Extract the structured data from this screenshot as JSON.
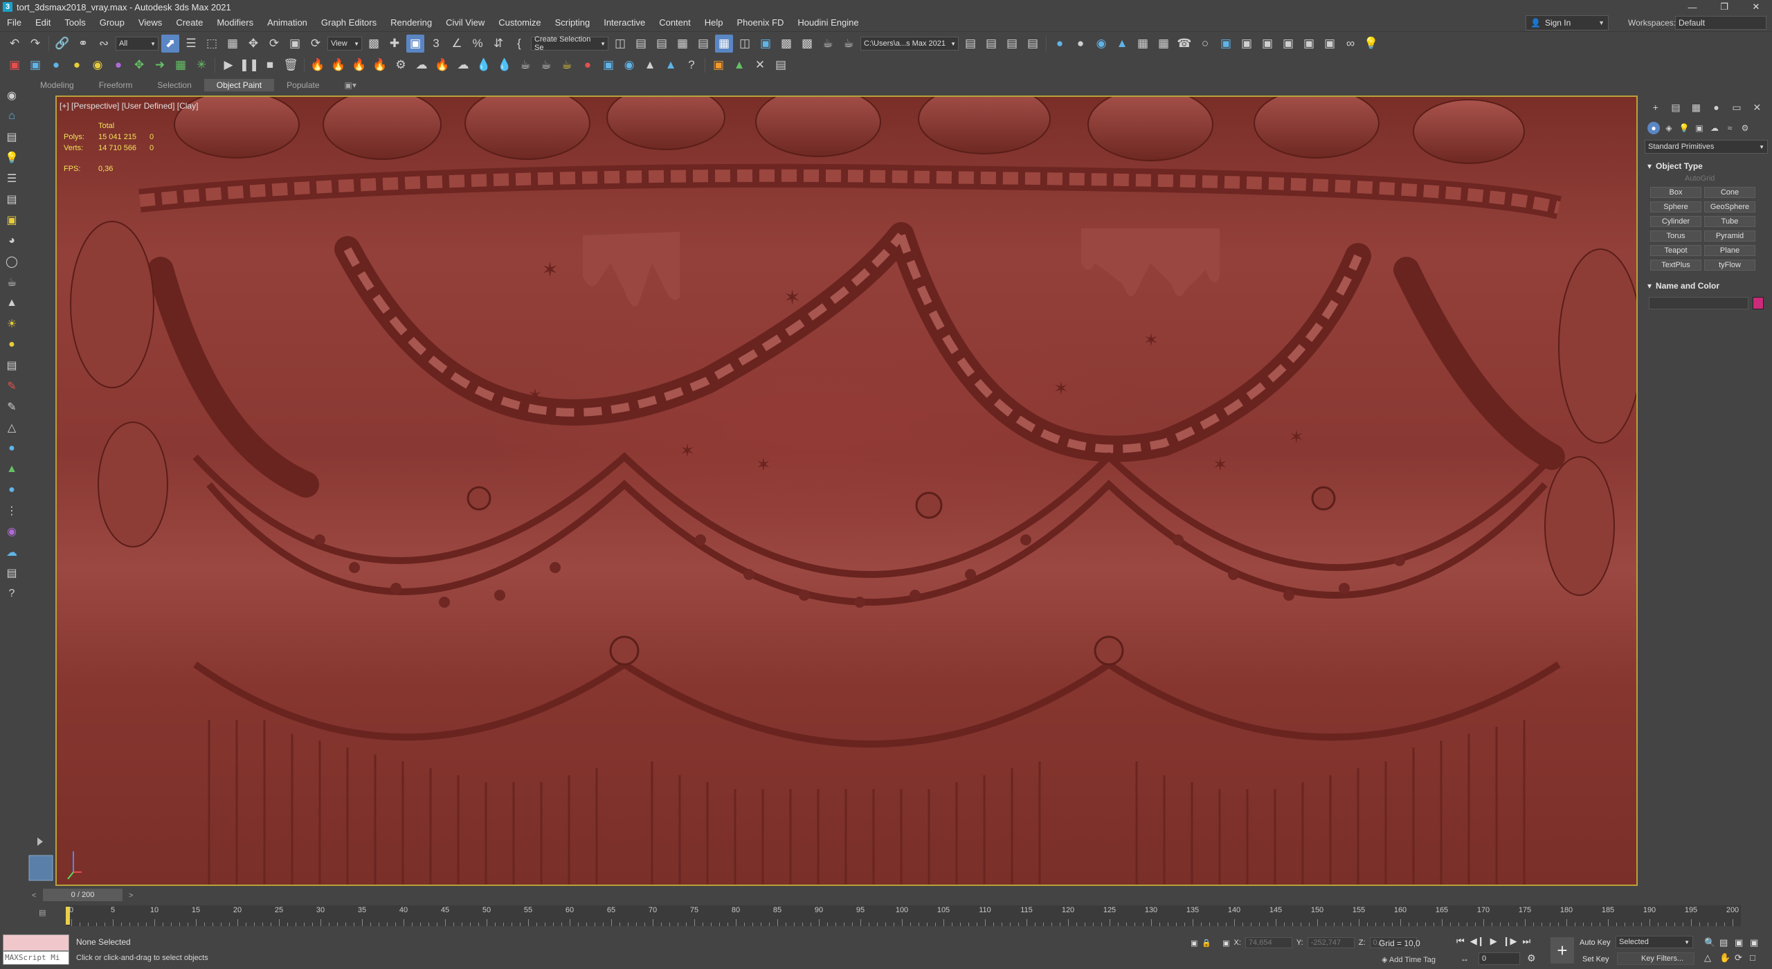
{
  "window": {
    "title": "tort_3dsmax2018_vray.max - Autodesk 3ds Max 2021",
    "app_icon": "3",
    "minimize": "—",
    "maximize": "❐",
    "close": "✕"
  },
  "menu": [
    "File",
    "Edit",
    "Tools",
    "Group",
    "Views",
    "Create",
    "Modifiers",
    "Animation",
    "Graph Editors",
    "Rendering",
    "Civil View",
    "Customize",
    "Scripting",
    "Interactive",
    "Content",
    "Help",
    "Phoenix FD",
    "Houdini Engine"
  ],
  "signin": {
    "label": "Sign In",
    "icon": "user-icon"
  },
  "workspaces": {
    "label": "Workspaces:",
    "value": "Default"
  },
  "toolbar": {
    "filter_value": "All",
    "view_value": "View",
    "selection_set_value": "Create Selection Se",
    "path_value": "C:\\Users\\a...s Max 2021"
  },
  "ribbon_tabs": [
    "Modeling",
    "Freeform",
    "Selection",
    "Object Paint",
    "Populate"
  ],
  "ribbon_active": "Object Paint",
  "viewport": {
    "label": "[+] [Perspective] [User Defined] [Clay]",
    "stats": {
      "total_label": "Total",
      "polys_label": "Polys:",
      "polys_total": "15 041 215",
      "polys_sel": "0",
      "verts_label": "Verts:",
      "verts_total": "14 710 566",
      "verts_sel": "0",
      "fps_label": "FPS:",
      "fps_value": "0,36"
    }
  },
  "command_panel": {
    "category": "Standard Primitives",
    "object_type_title": "Object Type",
    "autogrid": "AutoGrid",
    "primitives": [
      "Box",
      "Cone",
      "Sphere",
      "GeoSphere",
      "Cylinder",
      "Tube",
      "Torus",
      "Pyramid",
      "Teapot",
      "Plane",
      "TextPlus",
      "tyFlow"
    ],
    "name_color_title": "Name and Color",
    "object_color": "#cc2a7a"
  },
  "timeline": {
    "slider_value": "0 / 200",
    "ticks": [
      0,
      5,
      10,
      15,
      20,
      25,
      30,
      35,
      40,
      45,
      50,
      55,
      60,
      65,
      70,
      75,
      80,
      85,
      90,
      95,
      100,
      105,
      110,
      115,
      120,
      125,
      130,
      135,
      140,
      145,
      150,
      155,
      160,
      165,
      170,
      175,
      180,
      185,
      190,
      195,
      200
    ],
    "max": 200
  },
  "status": {
    "maxscript": "MAXScript Mi",
    "selection": "None Selected",
    "prompt": "Click or click-and-drag to select objects",
    "x_label": "X:",
    "x_value": "74,654",
    "y_label": "Y:",
    "y_value": "-252,747",
    "z_label": "Z:",
    "z_value": "0,0",
    "grid": "Grid = 10,0",
    "add_time_tag": "Add Time Tag",
    "frame": "0",
    "auto_key": "Auto Key",
    "set_key": "Set Key",
    "selected_value": "Selected",
    "key_filters": "Key Filters..."
  }
}
